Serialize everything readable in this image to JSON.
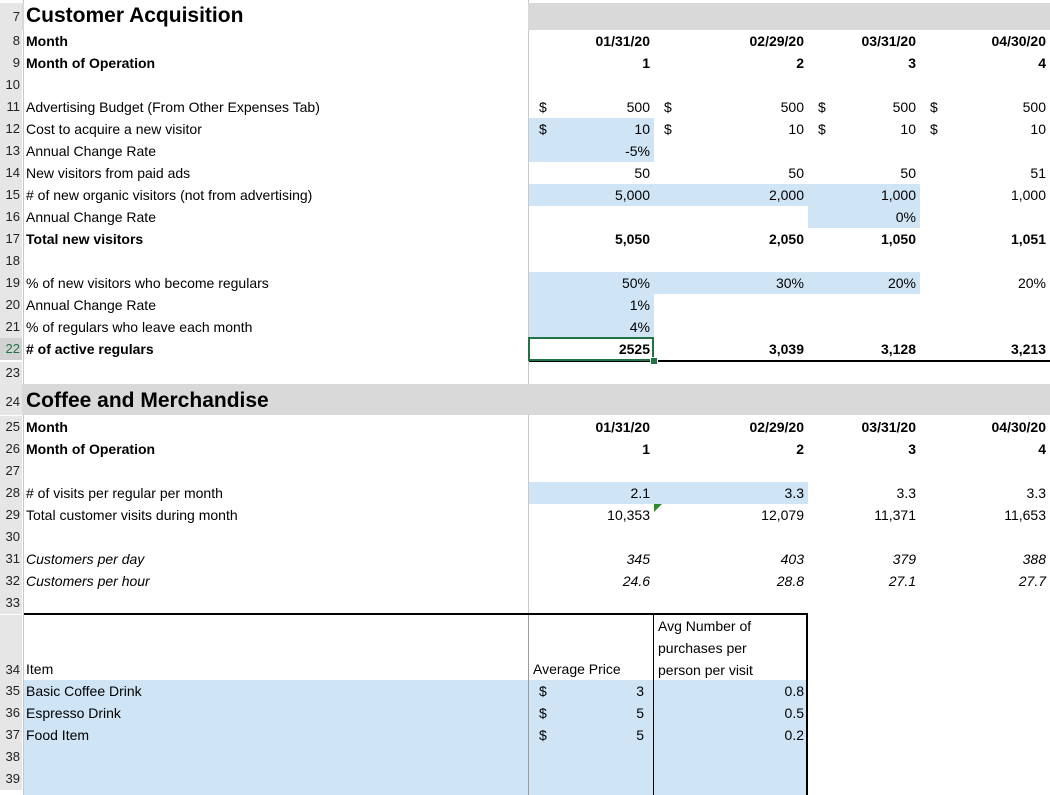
{
  "sections": {
    "acquisition": {
      "row": "7",
      "title": "Customer Acquisition",
      "month_row": "8",
      "month_label": "Month",
      "months": [
        "01/31/20",
        "02/29/20",
        "03/31/20",
        "04/30/20"
      ],
      "op_row": "9",
      "op_label": "Month of Operation",
      "op": [
        "1",
        "2",
        "3",
        "4"
      ],
      "blank_row": "10",
      "ad_budget": {
        "row": "11",
        "label": "Advertising Budget (From Other Expenses Tab)",
        "currency": "$",
        "values": [
          "500",
          "500",
          "500",
          "500"
        ]
      },
      "cost_visitor": {
        "row": "12",
        "label": "Cost to acquire a new visitor",
        "currency": "$",
        "values": [
          "10",
          "10",
          "10",
          "10"
        ]
      },
      "annual_change_1": {
        "row": "13",
        "label": "Annual Change Rate",
        "value": "-5%"
      },
      "paid_visitors": {
        "row": "14",
        "label": "New visitors from paid ads",
        "values": [
          "50",
          "50",
          "50",
          "51"
        ]
      },
      "organic_visitors": {
        "row": "15",
        "label": "# of new organic visitors (not from advertising)",
        "values": [
          "5,000",
          "2,000",
          "1,000",
          "1,000"
        ]
      },
      "annual_change_2": {
        "row": "16",
        "label": "Annual Change Rate",
        "value": "0%"
      },
      "total_visitors": {
        "row": "17",
        "label": "Total new visitors",
        "values": [
          "5,050",
          "2,050",
          "1,050",
          "1,051"
        ]
      },
      "blank_row2": "18",
      "pct_regulars": {
        "row": "19",
        "label": "% of new visitors who become regulars",
        "values": [
          "50%",
          "30%",
          "20%",
          "20%"
        ]
      },
      "annual_change_3": {
        "row": "20",
        "label": "Annual Change Rate",
        "value": "1%"
      },
      "pct_leave": {
        "row": "21",
        "label": "% of regulars who leave each month",
        "value": "4%"
      },
      "active_regulars": {
        "row": "22",
        "label": "# of active regulars",
        "values": [
          "2525",
          "3,039",
          "3,128",
          "3,213"
        ]
      },
      "blank_row3": "23"
    },
    "coffee": {
      "row": "24",
      "title": "Coffee and Merchandise",
      "month_row": "25",
      "month_label": "Month",
      "months": [
        "01/31/20",
        "02/29/20",
        "03/31/20",
        "04/30/20"
      ],
      "op_row": "26",
      "op_label": "Month of Operation",
      "op": [
        "1",
        "2",
        "3",
        "4"
      ],
      "blank_row": "27",
      "visits_per_regular": {
        "row": "28",
        "label": "# of visits per regular per month",
        "values": [
          "2.1",
          "3.3",
          "3.3",
          "3.3"
        ]
      },
      "total_visits": {
        "row": "29",
        "label": "Total customer visits during month",
        "values": [
          "10,353",
          "12,079",
          "11,371",
          "11,653"
        ]
      },
      "blank_row2": "30",
      "per_day": {
        "row": "31",
        "label": "Customers per day",
        "values": [
          "345",
          "403",
          "379",
          "388"
        ]
      },
      "per_hour": {
        "row": "32",
        "label": "Customers per hour",
        "values": [
          "24.6",
          "28.8",
          "27.1",
          "27.7"
        ]
      },
      "blank_row3": "33"
    },
    "items": {
      "header_row": "34",
      "item_label": "Item",
      "price_label": "Average Price",
      "purchases_label_lines": [
        "Avg Number of",
        "purchases per",
        "person per visit"
      ],
      "list": [
        {
          "row": "35",
          "name": "Basic Coffee Drink",
          "currency": "$",
          "price": "3",
          "purchases": "0.8"
        },
        {
          "row": "36",
          "name": "Espresso Drink",
          "currency": "$",
          "price": "5",
          "purchases": "0.5"
        },
        {
          "row": "37",
          "name": "Food Item",
          "currency": "$",
          "price": "5",
          "purchases": "0.2"
        }
      ],
      "blank_rows": [
        "38",
        "39"
      ]
    }
  },
  "colors": {
    "input_fill": "#cfe4f4",
    "section_fill": "#d9d9d9",
    "selection": "#217346"
  }
}
